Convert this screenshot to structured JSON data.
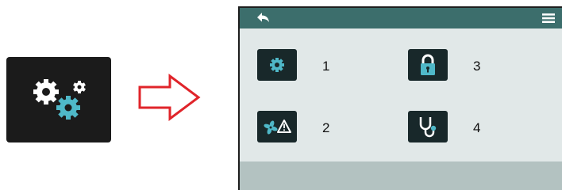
{
  "source_tile": {
    "icon": "settings-gears-icon"
  },
  "transition_arrow": {
    "icon": "right-arrow-outline-icon",
    "color": "#e0242a"
  },
  "device_screen": {
    "header": {
      "back_icon": "back-arrow-icon",
      "menu_icon": "hamburger-menu-icon",
      "color": "#3c6e6c"
    },
    "menu_items": [
      {
        "number": "1",
        "icon": "gear-icon"
      },
      {
        "number": "2",
        "icon": "fan-warning-icon"
      },
      {
        "number": "3",
        "icon": "padlock-icon"
      },
      {
        "number": "4",
        "icon": "stethoscope-icon"
      }
    ],
    "colors": {
      "screen_bg": "#e1e8e8",
      "button_bg": "#18282a",
      "accent": "#4fb8c8",
      "footer": "#b3c2c1"
    }
  }
}
